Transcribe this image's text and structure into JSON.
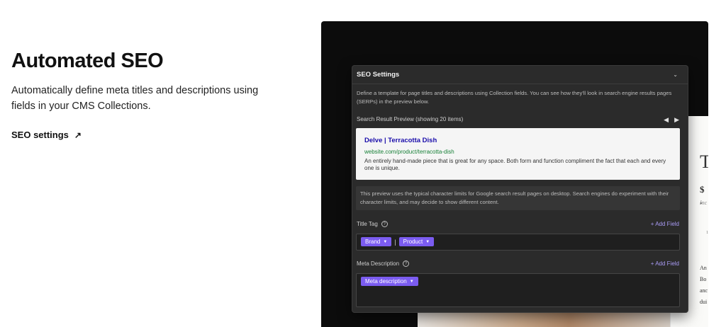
{
  "hero": {
    "title": "Automated SEO",
    "description": "Automatically define meta titles and descriptions using fields in your CMS Collections.",
    "link_label": "SEO settings",
    "link_arrow": "↗"
  },
  "background_page": {
    "heading_glyph": "T",
    "price_glyph": "$ .",
    "italic_glyph": "Inc",
    "small_glyph": "1",
    "text_lines": [
      "An",
      "Bo",
      "anc",
      "dui"
    ]
  },
  "panel": {
    "title": "SEO Settings",
    "collapse_icon": "chevron-down-icon",
    "intro": "Define a template for page titles and descriptions using Collection fields. You can see how they'll look in search engine results pages (SERPs) in the preview below.",
    "preview_label": "Search Result Preview (showing 20 items)",
    "pager": {
      "prev": "◀",
      "next": "▶"
    },
    "serp": {
      "title": "Delve | Terracotta Dish",
      "url": "website.com/product/terracotta-dish",
      "description": "An entirely hand-made piece that is great for any space. Both form and function compliment the fact that each and every one is unique."
    },
    "note": "This preview uses the typical character limits for Google search result pages on desktop. Search engines do experiment with their character limits, and may decide to show different content.",
    "title_tag": {
      "label": "Title Tag",
      "help": "?",
      "add_field": "+ Add Field",
      "tokens": [
        "Brand",
        "Product"
      ],
      "separator": "|"
    },
    "meta_description": {
      "label": "Meta Description",
      "help": "?",
      "add_field": "+ Add Field",
      "tokens": [
        "Meta description"
      ]
    }
  },
  "colors": {
    "accent": "#7b5cf0",
    "panel_bg": "#2b2b2b",
    "serp_link": "#1a0dab",
    "serp_url": "#188038"
  }
}
